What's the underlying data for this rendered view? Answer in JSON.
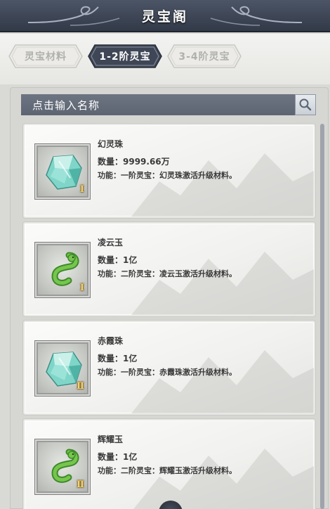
{
  "header": {
    "title": "灵宝阁"
  },
  "tabs": [
    {
      "label": "灵宝材料",
      "active": false
    },
    {
      "label": "1-2阶灵宝",
      "active": true
    },
    {
      "label": "3-4阶灵宝",
      "active": false
    }
  ],
  "search": {
    "placeholder": "点击输入名称",
    "icon": "magnifier-icon"
  },
  "items": [
    {
      "name": "幻灵珠",
      "quantity": "数量：9999.66万",
      "function": "功能：一阶灵宝：幻灵珠激活升级材料。",
      "tier": "Ⅰ",
      "icon": "crystal-icon"
    },
    {
      "name": "凌云玉",
      "quantity": "数量：1亿",
      "function": "功能：二阶灵宝：凌云玉激活升级材料。",
      "tier": "Ⅰ",
      "icon": "jade-dragon-icon"
    },
    {
      "name": "赤霞珠",
      "quantity": "数量：1亿",
      "function": "功能：一阶灵宝：赤霞珠激活升级材料。",
      "tier": "Ⅱ",
      "icon": "crystal-icon"
    },
    {
      "name": "辉耀玉",
      "quantity": "数量：1亿",
      "function": "功能：二阶灵宝：辉耀玉激活升级材料。",
      "tier": "Ⅱ",
      "icon": "jade-dragon-icon"
    }
  ],
  "colors": {
    "header_bg": "#3b4352",
    "active_tab": "#3f4756",
    "search_bg": "#646b79",
    "tier_gold": "#f5d36a",
    "crystal": "#7fd6c8",
    "jade": "#5faa3c"
  }
}
